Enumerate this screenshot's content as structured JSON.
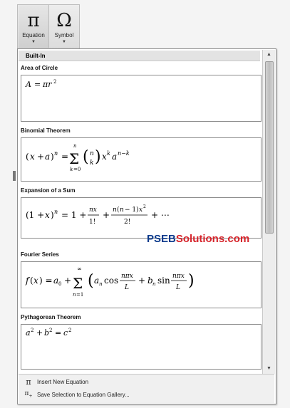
{
  "ribbon": {
    "equation_button": {
      "glyph": "π",
      "label": "Equation",
      "icon": "pi-icon"
    },
    "symbol_button": {
      "glyph": "Ω",
      "label": "Symbol",
      "icon": "omega-icon"
    }
  },
  "gallery": {
    "section_header": "Built-In",
    "entries": [
      {
        "title": "Area of Circle",
        "formula": "A = πr²"
      },
      {
        "title": "Binomial Theorem",
        "formula": "(x + a)^n = Σ_{k=0}^{n} (n choose k) x^k a^{n−k}"
      },
      {
        "title": "Expansion of a Sum",
        "formula": "(1 + x)^n = 1 + nx/1! + n(n − 1)x²/2! + ⋯"
      },
      {
        "title": "Fourier Series",
        "formula": "f(x) = a0 + Σ_{n=1}^{∞} (an cos nπx/L + bn sin nπx/L)"
      },
      {
        "title": "Pythagorean Theorem",
        "formula": "a² + b² = c²"
      }
    ]
  },
  "footer": {
    "insert_new": {
      "label": "Insert New Equation",
      "icon": "pi-icon"
    },
    "save_selection": {
      "label": "Save Selection to Equation Gallery...",
      "icon": "save-equation-icon"
    }
  },
  "watermark": {
    "part1": "PSEB",
    "part2": "Solutions.com"
  }
}
